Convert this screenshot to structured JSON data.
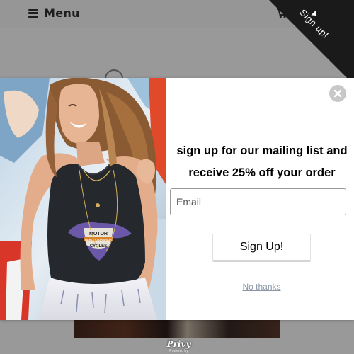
{
  "header": {
    "menu_label": "Menu",
    "menu_icon": "hamburger-icon",
    "cart_icon": "cart-icon"
  },
  "ribbon": {
    "label": "Sign up!",
    "background_color": "#1a1a1a",
    "icon": "caret-down-icon"
  },
  "popup": {
    "close_icon": "close-icon",
    "headline_line1": "sign up for our mailing list and",
    "headline_line2": "receive 25% off your order",
    "email_placeholder": "Email",
    "email_value": "",
    "signup_button_label": "Sign Up!",
    "decline_link_label": "No thanks",
    "decline_link_color": "#8a96a6",
    "graphic_print_lines": [
      "MOTOR",
      "HARLEY-DAVIDSON",
      "CYCLES"
    ]
  },
  "footer_badge": {
    "logo": "Privy",
    "subtext": "Powered by"
  }
}
